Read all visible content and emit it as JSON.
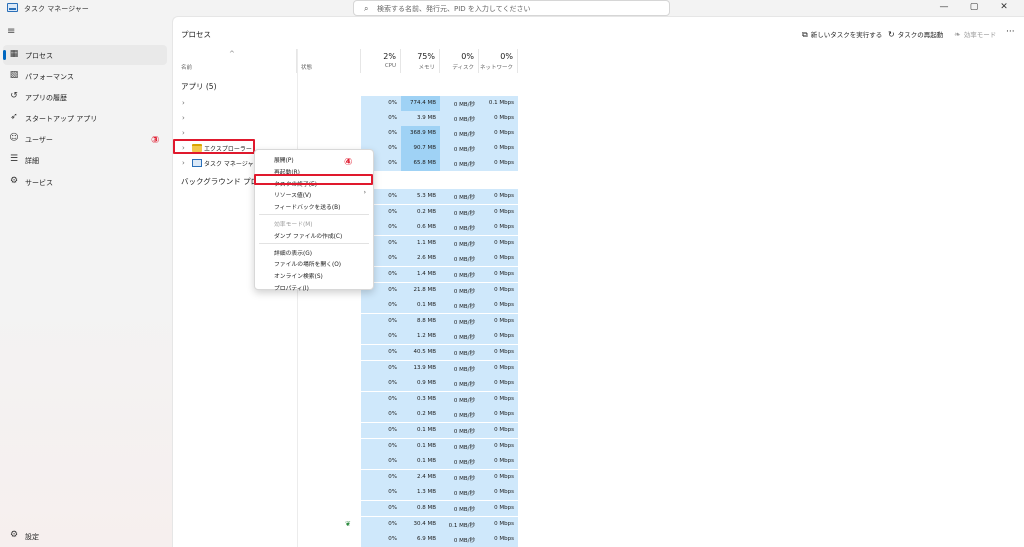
{
  "window": {
    "title": "タスク マネージャー",
    "search_placeholder": "検索する名前、発行元、PID を入力してください",
    "controls": [
      "—",
      "▢",
      "✕"
    ]
  },
  "sidebar": {
    "items": [
      {
        "label": "プロセス",
        "icon": "process-grid-icon"
      },
      {
        "label": "パフォーマンス",
        "icon": "performance-chart-icon"
      },
      {
        "label": "アプリの履歴",
        "icon": "history-icon"
      },
      {
        "label": "スタートアップ アプリ",
        "icon": "startup-icon"
      },
      {
        "label": "ユーザー",
        "icon": "users-icon"
      },
      {
        "label": "詳細",
        "icon": "details-list-icon"
      },
      {
        "label": "サービス",
        "icon": "services-gear-icon"
      }
    ],
    "settings_label": "設定",
    "selected_index": 0
  },
  "toolbar": {
    "page_title": "プロセス",
    "run_new_task": "新しいタスクを実行する",
    "restart_task": "タスクの再起動",
    "efficiency_mode": "効率モード",
    "more": "···"
  },
  "columns": {
    "name": "名前",
    "status": "状態",
    "cpu": {
      "pct": "2%",
      "label": "CPU"
    },
    "memory": {
      "pct": "75%",
      "label": "メモリ"
    },
    "disk": {
      "pct": "0%",
      "label": "ディスク"
    },
    "network": {
      "pct": "0%",
      "label": "ネットワーク"
    }
  },
  "groups": {
    "apps": "アプリ (5)",
    "background": "バックグラウンド プロセ"
  },
  "app_rows": [
    {
      "name": "",
      "cpu": "0%",
      "mem": "774.4 MB",
      "disk": "0 MB/秒",
      "net": "0.1 Mbps",
      "mem_heat": 2
    },
    {
      "name": "",
      "cpu": "0%",
      "mem": "3.9 MB",
      "disk": "0 MB/秒",
      "net": "0 Mbps",
      "mem_heat": 1
    },
    {
      "name": "",
      "cpu": "0%",
      "mem": "368.9 MB",
      "disk": "0 MB/秒",
      "net": "0 Mbps",
      "mem_heat": 2
    },
    {
      "name": "エクスプローラー",
      "cpu": "0%",
      "mem": "90.7 MB",
      "disk": "0 MB/秒",
      "net": "0 Mbps",
      "mem_heat": 2
    },
    {
      "name": "タスク マネージャー",
      "cpu": "0%",
      "mem": "65.8 MB",
      "disk": "0 MB/秒",
      "net": "0 Mbps",
      "mem_heat": 2
    }
  ],
  "bg_rows": [
    {
      "cpu": "0%",
      "mem": "5.3 MB",
      "disk": "0 MB/秒",
      "net": "0 Mbps"
    },
    {
      "cpu": "0%",
      "mem": "0.2 MB",
      "disk": "0 MB/秒",
      "net": "0 Mbps"
    },
    {
      "cpu": "0%",
      "mem": "0.6 MB",
      "disk": "0 MB/秒",
      "net": "0 Mbps"
    },
    {
      "cpu": "0%",
      "mem": "1.1 MB",
      "disk": "0 MB/秒",
      "net": "0 Mbps"
    },
    {
      "cpu": "0%",
      "mem": "2.6 MB",
      "disk": "0 MB/秒",
      "net": "0 Mbps"
    },
    {
      "cpu": "0%",
      "mem": "1.4 MB",
      "disk": "0 MB/秒",
      "net": "0 Mbps"
    },
    {
      "cpu": "0%",
      "mem": "21.8 MB",
      "disk": "0 MB/秒",
      "net": "0 Mbps"
    },
    {
      "cpu": "0%",
      "mem": "0.1 MB",
      "disk": "0 MB/秒",
      "net": "0 Mbps"
    },
    {
      "cpu": "0%",
      "mem": "8.8 MB",
      "disk": "0 MB/秒",
      "net": "0 Mbps"
    },
    {
      "cpu": "0%",
      "mem": "1.2 MB",
      "disk": "0 MB/秒",
      "net": "0 Mbps"
    },
    {
      "cpu": "0%",
      "mem": "40.5 MB",
      "disk": "0 MB/秒",
      "net": "0 Mbps"
    },
    {
      "cpu": "0%",
      "mem": "13.9 MB",
      "disk": "0 MB/秒",
      "net": "0 Mbps"
    },
    {
      "cpu": "0%",
      "mem": "0.9 MB",
      "disk": "0 MB/秒",
      "net": "0 Mbps"
    },
    {
      "cpu": "0%",
      "mem": "0.3 MB",
      "disk": "0 MB/秒",
      "net": "0 Mbps"
    },
    {
      "cpu": "0%",
      "mem": "0.2 MB",
      "disk": "0 MB/秒",
      "net": "0 Mbps"
    },
    {
      "cpu": "0%",
      "mem": "0.1 MB",
      "disk": "0 MB/秒",
      "net": "0 Mbps"
    },
    {
      "cpu": "0%",
      "mem": "0.1 MB",
      "disk": "0 MB/秒",
      "net": "0 Mbps"
    },
    {
      "cpu": "0%",
      "mem": "0.1 MB",
      "disk": "0 MB/秒",
      "net": "0 Mbps"
    },
    {
      "cpu": "0%",
      "mem": "2.4 MB",
      "disk": "0 MB/秒",
      "net": "0 Mbps"
    },
    {
      "cpu": "0%",
      "mem": "1.3 MB",
      "disk": "0 MB/秒",
      "net": "0 Mbps"
    },
    {
      "cpu": "0%",
      "mem": "0.8 MB",
      "disk": "0 MB/秒",
      "net": "0 Mbps"
    },
    {
      "cpu": "0%",
      "mem": "30.4 MB",
      "disk": "0.1 MB/秒",
      "net": "0 Mbps",
      "leaf": true
    },
    {
      "cpu": "0%",
      "mem": "6.9 MB",
      "disk": "0 MB/秒",
      "net": "0 Mbps"
    },
    {
      "cpu": "0%",
      "mem": "2.4 MB",
      "disk": "0 MB/秒",
      "net": "0 Mbps"
    }
  ],
  "context_menu": {
    "items": [
      {
        "label": "展開(P)",
        "disabled": false
      },
      {
        "label": "再起動(R)",
        "disabled": false
      },
      {
        "label": "タスクの終了(E)",
        "disabled": false
      },
      {
        "label": "リソース値(V)",
        "disabled": false,
        "submenu": true
      },
      {
        "label": "フィードバックを送る(B)",
        "disabled": false
      },
      {
        "sep": true
      },
      {
        "label": "効率モード(M)",
        "disabled": true
      },
      {
        "label": "ダンプ ファイルの作成(C)",
        "disabled": false
      },
      {
        "sep": true
      },
      {
        "label": "詳細の表示(G)",
        "disabled": false
      },
      {
        "label": "ファイルの場所を開く(O)",
        "disabled": false
      },
      {
        "label": "オンライン検索(S)",
        "disabled": false
      },
      {
        "label": "プロパティ(I)",
        "disabled": false
      }
    ]
  },
  "annotations": {
    "step3": "③",
    "step4": "④"
  },
  "colors": {
    "accent": "#0067c0",
    "heat_light": "#cfe8fb",
    "heat_strong": "#9fd2f5",
    "annotation": "#e0192d"
  }
}
